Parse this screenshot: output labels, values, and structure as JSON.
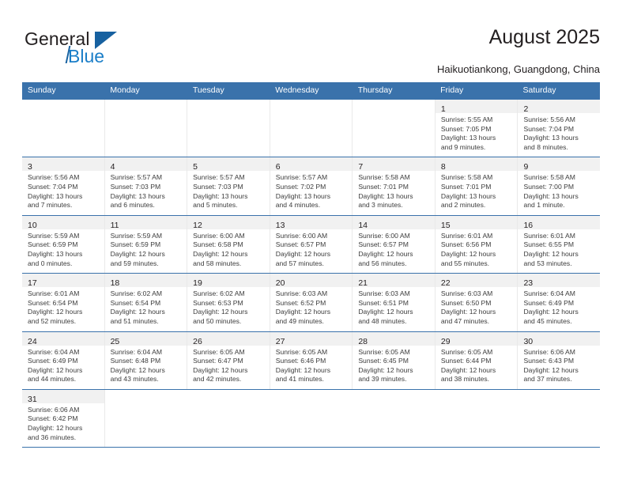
{
  "brand": {
    "name_part1": "General",
    "name_part2": "Blue",
    "triangle_color": "#1761a0",
    "blue_text_color": "#1a7ec8"
  },
  "header": {
    "title": "August 2025",
    "subtitle": "Haikuotiankong, Guangdong, China"
  },
  "theme": {
    "header_blue": "#3a72ab",
    "daynum_band": "#f1f1f1",
    "grid_line": "#e9e9e9",
    "text": "#231f20"
  },
  "weekday_headers": [
    "Sunday",
    "Monday",
    "Tuesday",
    "Wednesday",
    "Thursday",
    "Friday",
    "Saturday"
  ],
  "labels": {
    "sunrise_prefix": "Sunrise:",
    "sunset_prefix": "Sunset:",
    "daylight_prefix": "Daylight:"
  },
  "weeks": [
    [
      {
        "day": "",
        "lines": []
      },
      {
        "day": "",
        "lines": []
      },
      {
        "day": "",
        "lines": []
      },
      {
        "day": "",
        "lines": []
      },
      {
        "day": "",
        "lines": []
      },
      {
        "day": "1",
        "lines": [
          "Sunrise: 5:55 AM",
          "Sunset: 7:05 PM",
          "Daylight: 13 hours",
          "and 9 minutes."
        ]
      },
      {
        "day": "2",
        "lines": [
          "Sunrise: 5:56 AM",
          "Sunset: 7:04 PM",
          "Daylight: 13 hours",
          "and 8 minutes."
        ]
      }
    ],
    [
      {
        "day": "3",
        "lines": [
          "Sunrise: 5:56 AM",
          "Sunset: 7:04 PM",
          "Daylight: 13 hours",
          "and 7 minutes."
        ]
      },
      {
        "day": "4",
        "lines": [
          "Sunrise: 5:57 AM",
          "Sunset: 7:03 PM",
          "Daylight: 13 hours",
          "and 6 minutes."
        ]
      },
      {
        "day": "5",
        "lines": [
          "Sunrise: 5:57 AM",
          "Sunset: 7:03 PM",
          "Daylight: 13 hours",
          "and 5 minutes."
        ]
      },
      {
        "day": "6",
        "lines": [
          "Sunrise: 5:57 AM",
          "Sunset: 7:02 PM",
          "Daylight: 13 hours",
          "and 4 minutes."
        ]
      },
      {
        "day": "7",
        "lines": [
          "Sunrise: 5:58 AM",
          "Sunset: 7:01 PM",
          "Daylight: 13 hours",
          "and 3 minutes."
        ]
      },
      {
        "day": "8",
        "lines": [
          "Sunrise: 5:58 AM",
          "Sunset: 7:01 PM",
          "Daylight: 13 hours",
          "and 2 minutes."
        ]
      },
      {
        "day": "9",
        "lines": [
          "Sunrise: 5:58 AM",
          "Sunset: 7:00 PM",
          "Daylight: 13 hours",
          "and 1 minute."
        ]
      }
    ],
    [
      {
        "day": "10",
        "lines": [
          "Sunrise: 5:59 AM",
          "Sunset: 6:59 PM",
          "Daylight: 13 hours",
          "and 0 minutes."
        ]
      },
      {
        "day": "11",
        "lines": [
          "Sunrise: 5:59 AM",
          "Sunset: 6:59 PM",
          "Daylight: 12 hours",
          "and 59 minutes."
        ]
      },
      {
        "day": "12",
        "lines": [
          "Sunrise: 6:00 AM",
          "Sunset: 6:58 PM",
          "Daylight: 12 hours",
          "and 58 minutes."
        ]
      },
      {
        "day": "13",
        "lines": [
          "Sunrise: 6:00 AM",
          "Sunset: 6:57 PM",
          "Daylight: 12 hours",
          "and 57 minutes."
        ]
      },
      {
        "day": "14",
        "lines": [
          "Sunrise: 6:00 AM",
          "Sunset: 6:57 PM",
          "Daylight: 12 hours",
          "and 56 minutes."
        ]
      },
      {
        "day": "15",
        "lines": [
          "Sunrise: 6:01 AM",
          "Sunset: 6:56 PM",
          "Daylight: 12 hours",
          "and 55 minutes."
        ]
      },
      {
        "day": "16",
        "lines": [
          "Sunrise: 6:01 AM",
          "Sunset: 6:55 PM",
          "Daylight: 12 hours",
          "and 53 minutes."
        ]
      }
    ],
    [
      {
        "day": "17",
        "lines": [
          "Sunrise: 6:01 AM",
          "Sunset: 6:54 PM",
          "Daylight: 12 hours",
          "and 52 minutes."
        ]
      },
      {
        "day": "18",
        "lines": [
          "Sunrise: 6:02 AM",
          "Sunset: 6:54 PM",
          "Daylight: 12 hours",
          "and 51 minutes."
        ]
      },
      {
        "day": "19",
        "lines": [
          "Sunrise: 6:02 AM",
          "Sunset: 6:53 PM",
          "Daylight: 12 hours",
          "and 50 minutes."
        ]
      },
      {
        "day": "20",
        "lines": [
          "Sunrise: 6:03 AM",
          "Sunset: 6:52 PM",
          "Daylight: 12 hours",
          "and 49 minutes."
        ]
      },
      {
        "day": "21",
        "lines": [
          "Sunrise: 6:03 AM",
          "Sunset: 6:51 PM",
          "Daylight: 12 hours",
          "and 48 minutes."
        ]
      },
      {
        "day": "22",
        "lines": [
          "Sunrise: 6:03 AM",
          "Sunset: 6:50 PM",
          "Daylight: 12 hours",
          "and 47 minutes."
        ]
      },
      {
        "day": "23",
        "lines": [
          "Sunrise: 6:04 AM",
          "Sunset: 6:49 PM",
          "Daylight: 12 hours",
          "and 45 minutes."
        ]
      }
    ],
    [
      {
        "day": "24",
        "lines": [
          "Sunrise: 6:04 AM",
          "Sunset: 6:49 PM",
          "Daylight: 12 hours",
          "and 44 minutes."
        ]
      },
      {
        "day": "25",
        "lines": [
          "Sunrise: 6:04 AM",
          "Sunset: 6:48 PM",
          "Daylight: 12 hours",
          "and 43 minutes."
        ]
      },
      {
        "day": "26",
        "lines": [
          "Sunrise: 6:05 AM",
          "Sunset: 6:47 PM",
          "Daylight: 12 hours",
          "and 42 minutes."
        ]
      },
      {
        "day": "27",
        "lines": [
          "Sunrise: 6:05 AM",
          "Sunset: 6:46 PM",
          "Daylight: 12 hours",
          "and 41 minutes."
        ]
      },
      {
        "day": "28",
        "lines": [
          "Sunrise: 6:05 AM",
          "Sunset: 6:45 PM",
          "Daylight: 12 hours",
          "and 39 minutes."
        ]
      },
      {
        "day": "29",
        "lines": [
          "Sunrise: 6:05 AM",
          "Sunset: 6:44 PM",
          "Daylight: 12 hours",
          "and 38 minutes."
        ]
      },
      {
        "day": "30",
        "lines": [
          "Sunrise: 6:06 AM",
          "Sunset: 6:43 PM",
          "Daylight: 12 hours",
          "and 37 minutes."
        ]
      }
    ],
    [
      {
        "day": "31",
        "lines": [
          "Sunrise: 6:06 AM",
          "Sunset: 6:42 PM",
          "Daylight: 12 hours",
          "and 36 minutes."
        ]
      },
      {
        "day": "",
        "lines": []
      },
      {
        "day": "",
        "lines": []
      },
      {
        "day": "",
        "lines": []
      },
      {
        "day": "",
        "lines": []
      },
      {
        "day": "",
        "lines": []
      },
      {
        "day": "",
        "lines": []
      }
    ]
  ]
}
